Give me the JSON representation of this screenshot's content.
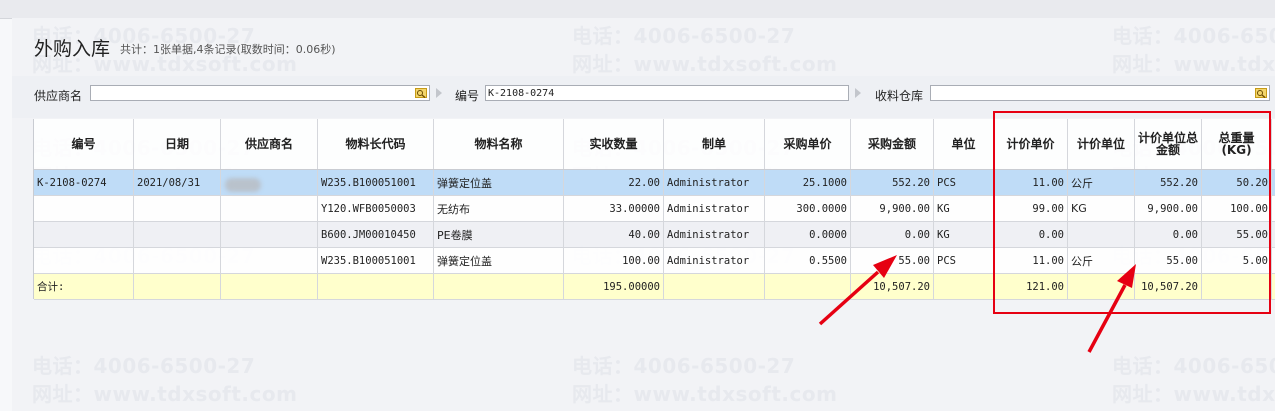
{
  "page": {
    "title": "外购入库",
    "summary": "共计：1张单据,4条记录(取数时间：0.06秒)"
  },
  "watermark": {
    "phone": "电话：4006-6500-27",
    "site": "网址：www.tdxsoft.com"
  },
  "filters": {
    "supplier_label": "供应商名",
    "supplier_value": "",
    "code_label": "编号",
    "code_value": "K-2108-0274",
    "warehouse_label": "收料仓库",
    "warehouse_value": ""
  },
  "table": {
    "headers": [
      "编号",
      "日期",
      "供应商名",
      "物料长代码",
      "物料名称",
      "实收数量",
      "制单",
      "采购单价",
      "采购金额",
      "单位",
      "计价单价",
      "计价单位",
      "计价单位总金额",
      "总重量(KG)"
    ],
    "rows": [
      [
        "K-2108-0274",
        "2021/08/31",
        "",
        "W235.B100051001",
        "弹簧定位盖",
        "22.00",
        "Administrator",
        "25.1000",
        "552.20",
        "PCS",
        "11.00",
        "公斤",
        "552.20",
        "50.20"
      ],
      [
        "",
        "",
        "",
        "Y120.WFB0050003",
        "无纺布",
        "33.00000",
        "Administrator",
        "300.0000",
        "9,900.00",
        "KG",
        "99.00",
        "KG",
        "9,900.00",
        "100.00"
      ],
      [
        "",
        "",
        "",
        "B600.JM00010450",
        "PE卷膜",
        "40.00",
        "Administrator",
        "0.0000",
        "0.00",
        "KG",
        "0.00",
        "",
        "0.00",
        "55.00"
      ],
      [
        "",
        "",
        "",
        "W235.B100051001",
        "弹簧定位盖",
        "100.00",
        "Administrator",
        "0.5500",
        "55.00",
        "PCS",
        "11.00",
        "公斤",
        "55.00",
        "5.00"
      ]
    ],
    "total": [
      "合计:",
      "",
      "",
      "",
      "",
      "195.00000",
      "",
      "",
      "10,507.20",
      "",
      "121.00",
      "",
      "10,507.20",
      ""
    ]
  },
  "colors": {
    "selected_row": "#bfdcf7",
    "total_row": "#ffffcc",
    "annotation_red": "#e60012"
  }
}
